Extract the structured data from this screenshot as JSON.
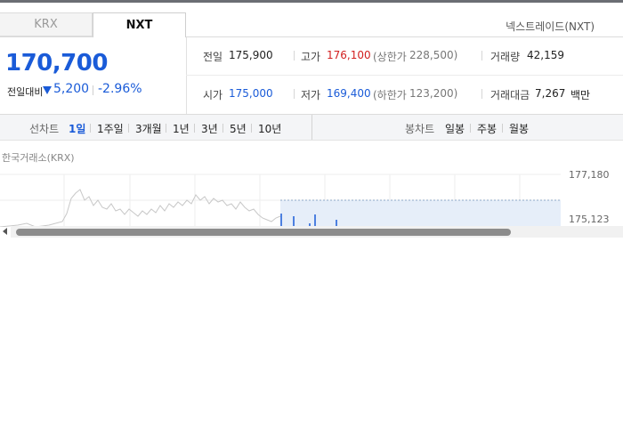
{
  "tabs": [
    {
      "label": "KRX",
      "active": false
    },
    {
      "label": "NXT",
      "active": true
    }
  ],
  "nxt_link": "넥스트레이드(NXT)",
  "price": {
    "current": "170,700",
    "compare_label": "전일대비",
    "change": "5,200",
    "change_pct": "-2.96%",
    "direction": "down"
  },
  "stats": {
    "prev_close": {
      "label": "전일",
      "value": "175,900"
    },
    "high": {
      "label": "고가",
      "value": "176,100",
      "limit_label": "(상한가",
      "limit_value": "228,500)"
    },
    "volume": {
      "label": "거래량",
      "value": "42,159"
    },
    "open": {
      "label": "시가",
      "value": "175,000"
    },
    "low": {
      "label": "저가",
      "value": "169,400",
      "limit_label": "(하한가",
      "limit_value": "123,200)"
    },
    "amount": {
      "label": "거래대금",
      "value": "7,267",
      "unit": "백만"
    }
  },
  "toolbar": {
    "line_chart_label": "선차트",
    "periods": [
      "1일",
      "1주일",
      "3개월",
      "1년",
      "3년",
      "5년",
      "10년"
    ],
    "active_period": "1일",
    "candle_label": "봉차트",
    "candles": [
      "일봉",
      "주봉",
      "월봉"
    ]
  },
  "chart": {
    "market_label": "한국거래소(KRX)",
    "y_ticks": [
      "177,180",
      "175,123"
    ]
  },
  "colors": {
    "up": "#d21f1f",
    "down": "#1a5bd8",
    "krx_line": "#c8c8c8",
    "nxt_line": "#1a5bd8",
    "nxt_area": "#e6eef9"
  }
}
